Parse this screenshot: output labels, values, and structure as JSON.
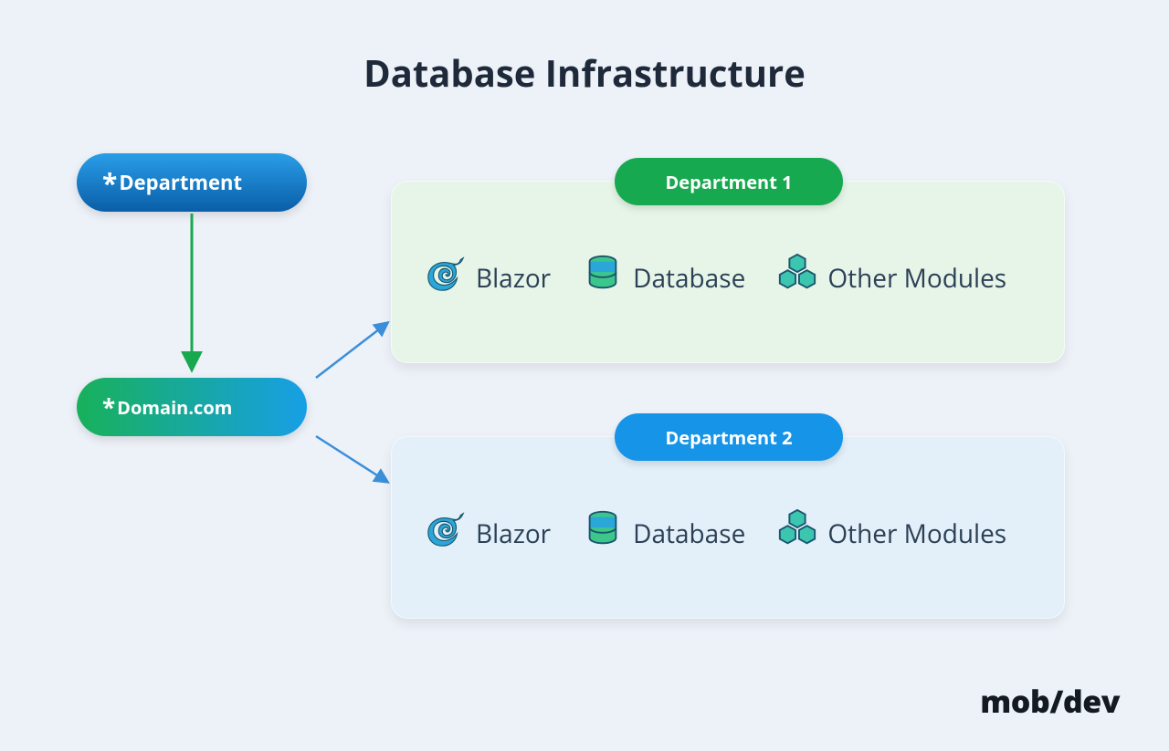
{
  "title": "Database Infrastructure",
  "nodes": {
    "department": "Department",
    "domain": "Domain.com"
  },
  "cards": [
    {
      "header": "Department 1",
      "modules": [
        "Blazor",
        "Database",
        "Other Modules"
      ]
    },
    {
      "header": "Department 2",
      "modules": [
        "Blazor",
        "Database",
        "Other Modules"
      ]
    }
  ],
  "brand": {
    "part1": "mob",
    "slash": "/",
    "part2": "dev"
  },
  "colors": {
    "card1_bg": "#e7f5e8",
    "card2_bg": "#e3eff9",
    "hdr1": "#17a94f",
    "hdr2": "#1694e8",
    "arrow_green": "#18a850",
    "arrow_blue": "#3a8fd8"
  }
}
